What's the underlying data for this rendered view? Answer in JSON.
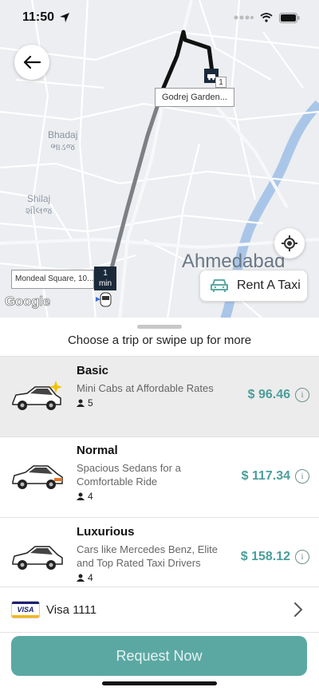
{
  "status_bar": {
    "time": "11:50"
  },
  "map": {
    "destination_label": "Godrej Garden...",
    "destination_badge": "1",
    "origin_label": "Mondeal Square, 10...",
    "eta_value": "1",
    "eta_unit": "min",
    "city_label": "Ahmedabad",
    "places": [
      {
        "name": "Bhadaj",
        "local": "ભાડજ"
      },
      {
        "name": "Shilaj",
        "local": "શીલજ"
      }
    ],
    "rent_button_label": "Rent A Taxi",
    "attribution": "Google"
  },
  "sheet": {
    "title": "Choose a trip or swipe up for more",
    "trips": [
      {
        "name": "Basic",
        "description": "Mini Cabs at Affordable Rates",
        "seats": "5",
        "price": "$ 96.46",
        "selected": true
      },
      {
        "name": "Normal",
        "description": "Spacious Sedans for a Comfortable Ride",
        "seats": "4",
        "price": "$ 117.34",
        "selected": false
      },
      {
        "name": "Luxurious",
        "description": "Cars like Mercedes Benz, Elite and Top Rated Taxi Drivers",
        "seats": "4",
        "price": "$ 158.12",
        "selected": false
      }
    ],
    "info_glyph": "i",
    "payment": {
      "brand": "VISA",
      "label": "Visa 1111"
    },
    "request_button_label": "Request Now"
  },
  "colors": {
    "accent": "#5ba8a3",
    "price": "#4a9e9b",
    "route": "#111111",
    "water": "#a9c6e8"
  }
}
